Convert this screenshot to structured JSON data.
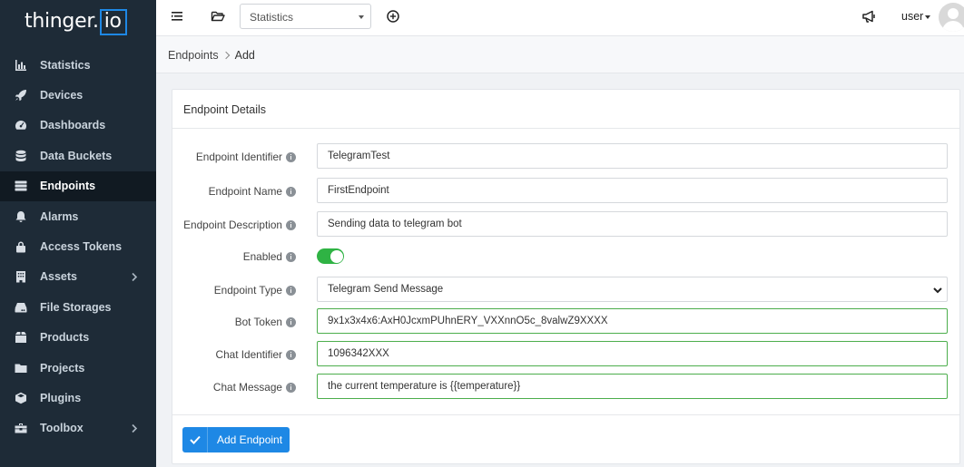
{
  "brand": {
    "prefix": "thinger.",
    "suffix": "io"
  },
  "sidebar": {
    "items": [
      {
        "label": "Statistics",
        "icon": "chart-icon",
        "active": false,
        "submenu": false
      },
      {
        "label": "Devices",
        "icon": "rocket-icon",
        "active": false,
        "submenu": false
      },
      {
        "label": "Dashboards",
        "icon": "gauge-icon",
        "active": false,
        "submenu": false
      },
      {
        "label": "Data Buckets",
        "icon": "database-icon",
        "active": false,
        "submenu": false
      },
      {
        "label": "Endpoints",
        "icon": "server-icon",
        "active": true,
        "submenu": false
      },
      {
        "label": "Alarms",
        "icon": "bell-icon",
        "active": false,
        "submenu": false
      },
      {
        "label": "Access Tokens",
        "icon": "lock-icon",
        "active": false,
        "submenu": false
      },
      {
        "label": "Assets",
        "icon": "building-icon",
        "active": false,
        "submenu": true
      },
      {
        "label": "File Storages",
        "icon": "hdd-icon",
        "active": false,
        "submenu": false
      },
      {
        "label": "Products",
        "icon": "box-icon",
        "active": false,
        "submenu": false
      },
      {
        "label": "Projects",
        "icon": "folder-icon",
        "active": false,
        "submenu": false
      },
      {
        "label": "Plugins",
        "icon": "cube-icon",
        "active": false,
        "submenu": false
      },
      {
        "label": "Toolbox",
        "icon": "toolbox-icon",
        "active": false,
        "submenu": true
      }
    ]
  },
  "topbar": {
    "select_value": "Statistics",
    "user_label": "user"
  },
  "breadcrumb": {
    "parent": "Endpoints",
    "current": "Add"
  },
  "form": {
    "title": "Endpoint Details",
    "fields": [
      {
        "label": "Endpoint Identifier",
        "value": "TelegramTest",
        "kind": "text",
        "valid": false
      },
      {
        "label": "Endpoint Name",
        "value": "FirstEndpoint",
        "kind": "text",
        "valid": false
      },
      {
        "label": "Endpoint Description",
        "value": "Sending data to telegram bot",
        "kind": "text",
        "valid": false
      },
      {
        "label": "Enabled",
        "value": "",
        "kind": "toggle",
        "valid": false
      },
      {
        "label": "Endpoint Type",
        "value": "Telegram Send Message",
        "kind": "select",
        "valid": false
      },
      {
        "label": "Bot Token",
        "value": "9x1x3x4x6:AxH0JcxmPUhnERY_VXXnnO5c_8valwZ9XXXX",
        "kind": "text",
        "valid": true
      },
      {
        "label": "Chat Identifier",
        "value": "1096342XXX",
        "kind": "text",
        "valid": true
      },
      {
        "label": "Chat Message",
        "value": "the current temperature is {{temperature}}",
        "kind": "text",
        "valid": true
      }
    ],
    "enabled": true,
    "submit_label": "Add Endpoint"
  },
  "colors": {
    "sidebar_bg": "#1e2b37",
    "accent": "#1e88e5",
    "success": "#2fb344"
  }
}
